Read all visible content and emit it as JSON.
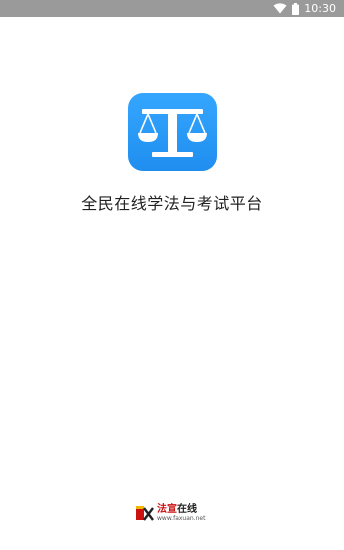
{
  "status_bar": {
    "time": "10:30",
    "icons": [
      "wifi-icon",
      "battery-icon"
    ]
  },
  "app": {
    "icon": "scales-of-justice-icon",
    "icon_gradient": [
      "#35a6ff",
      "#1f8eef"
    ],
    "slogan": "全民在线学法与考试平台"
  },
  "footer": {
    "brand_part1": "法宣",
    "brand_part2": "在线",
    "url": "www.faxuan.net",
    "brand_color": "#cc1111"
  }
}
